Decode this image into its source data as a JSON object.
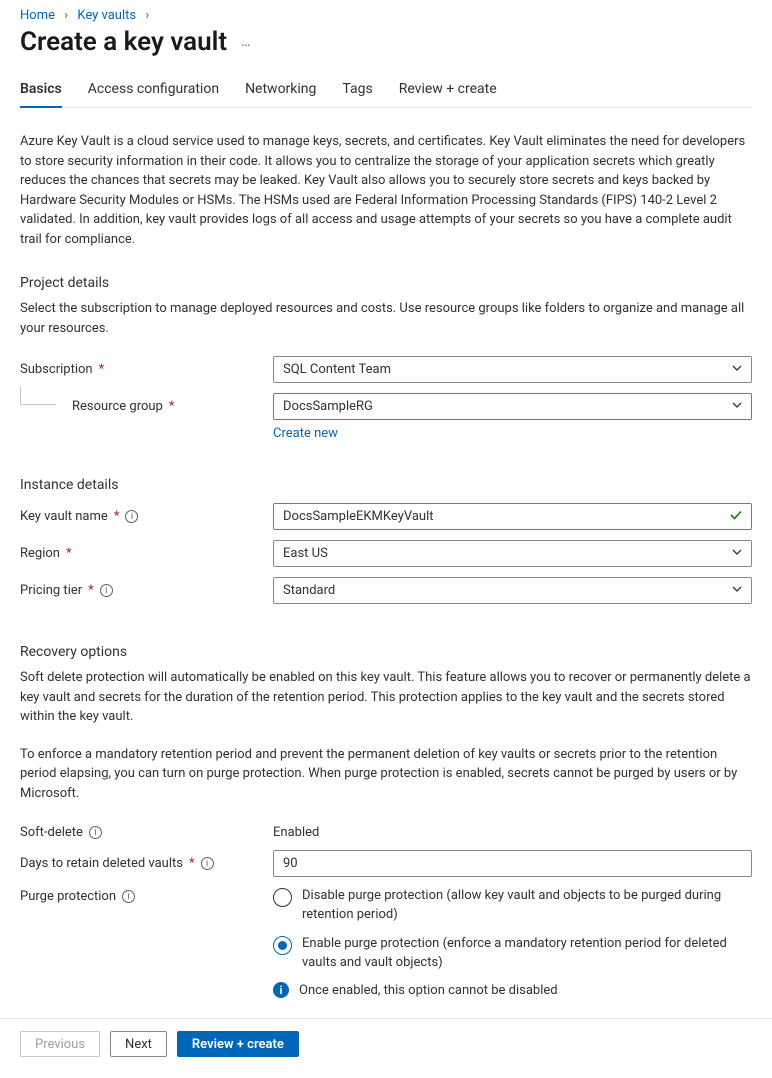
{
  "breadcrumb": {
    "home": "Home",
    "keyvaults": "Key vaults"
  },
  "page_title": "Create a key vault",
  "tabs": {
    "basics": "Basics",
    "access": "Access configuration",
    "networking": "Networking",
    "tags": "Tags",
    "review": "Review + create"
  },
  "intro": "Azure Key Vault is a cloud service used to manage keys, secrets, and certificates. Key Vault eliminates the need for developers to store security information in their code. It allows you to centralize the storage of your application secrets which greatly reduces the chances that secrets may be leaked. Key Vault also allows you to securely store secrets and keys backed by Hardware Security Modules or HSMs. The HSMs used are Federal Information Processing Standards (FIPS) 140-2 Level 2 validated. In addition, key vault provides logs of all access and usage attempts of your secrets so you have a complete audit trail for compliance.",
  "project": {
    "heading": "Project details",
    "desc": "Select the subscription to manage deployed resources and costs. Use resource groups like folders to organize and manage all your resources.",
    "subscription_label": "Subscription",
    "subscription_value": "SQL Content Team",
    "rg_label": "Resource group",
    "rg_value": "DocsSampleRG",
    "create_new": "Create new"
  },
  "instance": {
    "heading": "Instance details",
    "name_label": "Key vault name",
    "name_value": "DocsSampleEKMKeyVault",
    "region_label": "Region",
    "region_value": "East US",
    "tier_label": "Pricing tier",
    "tier_value": "Standard"
  },
  "recovery": {
    "heading": "Recovery options",
    "desc1": "Soft delete protection will automatically be enabled on this key vault. This feature allows you to recover or permanently delete a key vault and secrets for the duration of the retention period. This protection applies to the key vault and the secrets stored within the key vault.",
    "desc2": "To enforce a mandatory retention period and prevent the permanent deletion of key vaults or secrets prior to the retention period elapsing, you can turn on purge protection. When purge protection is enabled, secrets cannot be purged by users or by Microsoft.",
    "softdelete_label": "Soft-delete",
    "softdelete_value": "Enabled",
    "days_label": "Days to retain deleted vaults",
    "days_value": "90",
    "purge_label": "Purge protection",
    "purge_disable": "Disable purge protection (allow key vault and objects to be purged during retention period)",
    "purge_enable": "Enable purge protection (enforce a mandatory retention period for deleted vaults and vault objects)",
    "purge_note": "Once enabled, this option cannot be disabled"
  },
  "footer": {
    "previous": "Previous",
    "next": "Next",
    "review": "Review + create"
  }
}
